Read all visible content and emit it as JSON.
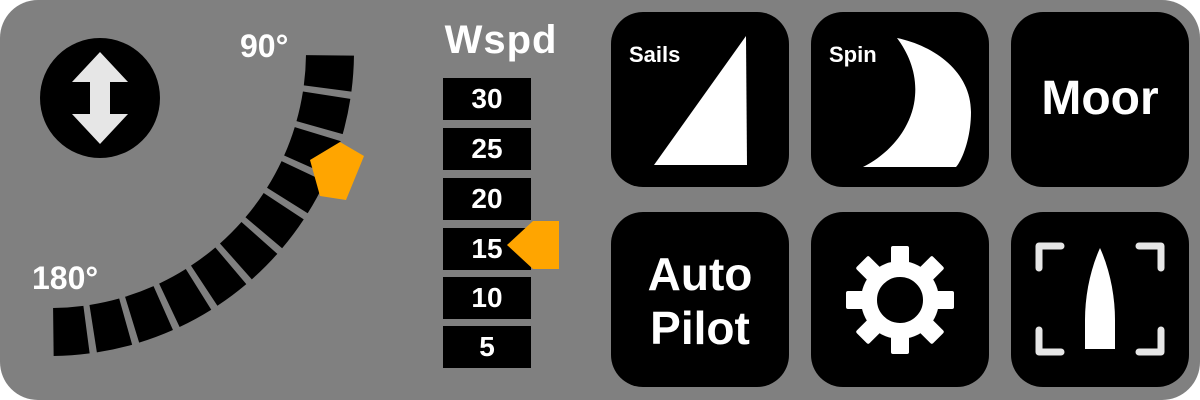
{
  "wind_angle": {
    "label_top": "90°",
    "label_bottom": "180°",
    "pointer_color": "#FFA500"
  },
  "wind_speed": {
    "title": "Wspd",
    "scale": [
      "30",
      "25",
      "20",
      "15",
      "10",
      "5"
    ],
    "current": "15",
    "pointer_color": "#FFA500"
  },
  "buttons": {
    "sails": {
      "label": "Sails",
      "icon": "triangle-sail-icon"
    },
    "spin": {
      "label": "Spin",
      "icon": "spinnaker-icon"
    },
    "moor": {
      "label": "Moor"
    },
    "autopilot": {
      "line1": "Auto",
      "line2": "Pilot"
    },
    "settings": {
      "icon": "gear-icon"
    },
    "boat_view": {
      "icon": "boat-focus-icon"
    }
  },
  "colors": {
    "panel": "#808080",
    "button": "#000000",
    "text": "#FFFFFF",
    "accent": "#FFA500"
  }
}
